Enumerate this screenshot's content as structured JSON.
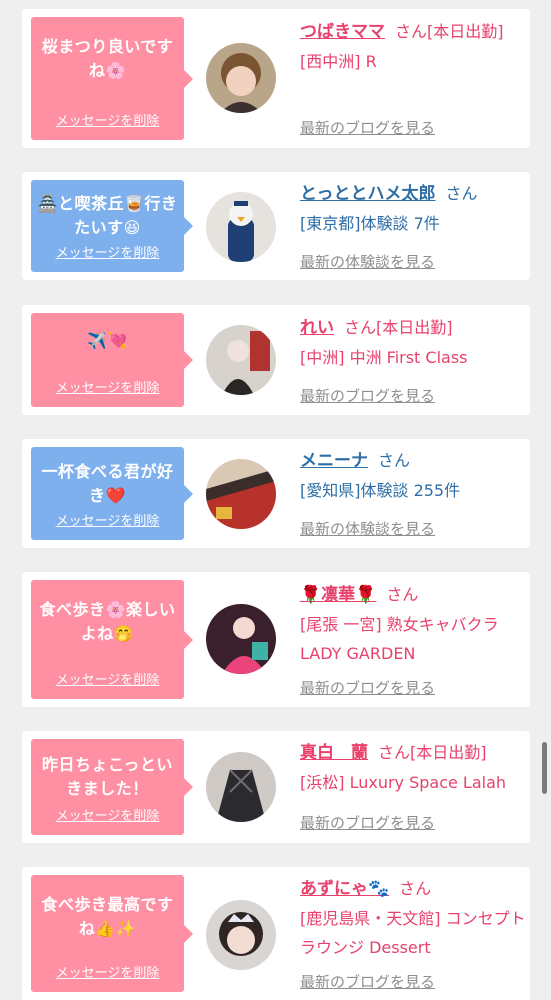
{
  "colors": {
    "bubble_pink": "#ff8fa3",
    "bubble_blue": "#7fb0ee",
    "text_pink": "#e8416c",
    "text_blue": "#2e6ea5",
    "link_gray": "#8e8e8e",
    "background": "#efefef"
  },
  "cards": [
    {
      "bubble_color": "pink",
      "message": "桜まつり良いですね🌸",
      "delete_label": "メッセージを削除",
      "name": "つばきママ",
      "san": "さん",
      "tag": "[本日出勤]",
      "detail": "[西中洲] R",
      "link": "最新のブログを見る",
      "text_color": "pink",
      "avatar_icon": "woman-portrait-avatar"
    },
    {
      "bubble_color": "blue",
      "message": "🏯と喫茶丘🥃行きたいす😆",
      "delete_label": "メッセージを削除",
      "name": "とっととハメ太郎",
      "san": "さん",
      "tag": "",
      "detail": "[東京都]体験談 7件",
      "link": "最新の体験談を見る",
      "text_color": "blue",
      "avatar_icon": "penguin-figure-avatar"
    },
    {
      "bubble_color": "pink",
      "message": "✈️💘",
      "delete_label": "メッセージを削除",
      "name": "れい",
      "san": "さん",
      "tag": "[本日出勤]",
      "detail": "[中洲] 中洲 First Class",
      "link": "最新のブログを見る",
      "text_color": "pink",
      "avatar_icon": "woman-photo-avatar"
    },
    {
      "bubble_color": "blue",
      "message": "一杯食べる君が好き❤️",
      "delete_label": "メッセージを削除",
      "name": "メニーナ",
      "san": "さん",
      "tag": "",
      "detail": "[愛知県]体験談 255件",
      "link": "最新の体験談を見る",
      "text_color": "blue",
      "avatar_icon": "patterned-cloth-avatar"
    },
    {
      "bubble_color": "pink",
      "message": "食べ歩き🌸楽しいよね🤭",
      "delete_label": "メッセージを削除",
      "name": "🌹凛華🌹",
      "san": "さん",
      "tag": "",
      "detail": "[尾張 一宮] 熟女キャバクラ LADY GARDEN",
      "link": "最新のブログを見る",
      "text_color": "pink",
      "avatar_icon": "kimono-woman-avatar"
    },
    {
      "bubble_color": "pink",
      "message": "昨日ちょこっといきました！",
      "delete_label": "メッセージを削除",
      "name": "真白　蘭",
      "san": "さん",
      "tag": "[本日出勤]",
      "detail": "[浜松] Luxury Space Lalah",
      "link": "最新のブログを見る",
      "text_color": "pink",
      "avatar_icon": "dark-outfit-avatar"
    },
    {
      "bubble_color": "pink",
      "message": "食べ歩き最高ですね👍✨",
      "delete_label": "メッセージを削除",
      "name": "あずにゃ🐾",
      "san": "さん",
      "tag": "",
      "detail": "[鹿児島県・天文館] コンセプトラウンジ Dessert",
      "link": "最新のブログを見る",
      "text_color": "pink",
      "avatar_icon": "tiara-girl-avatar"
    }
  ]
}
